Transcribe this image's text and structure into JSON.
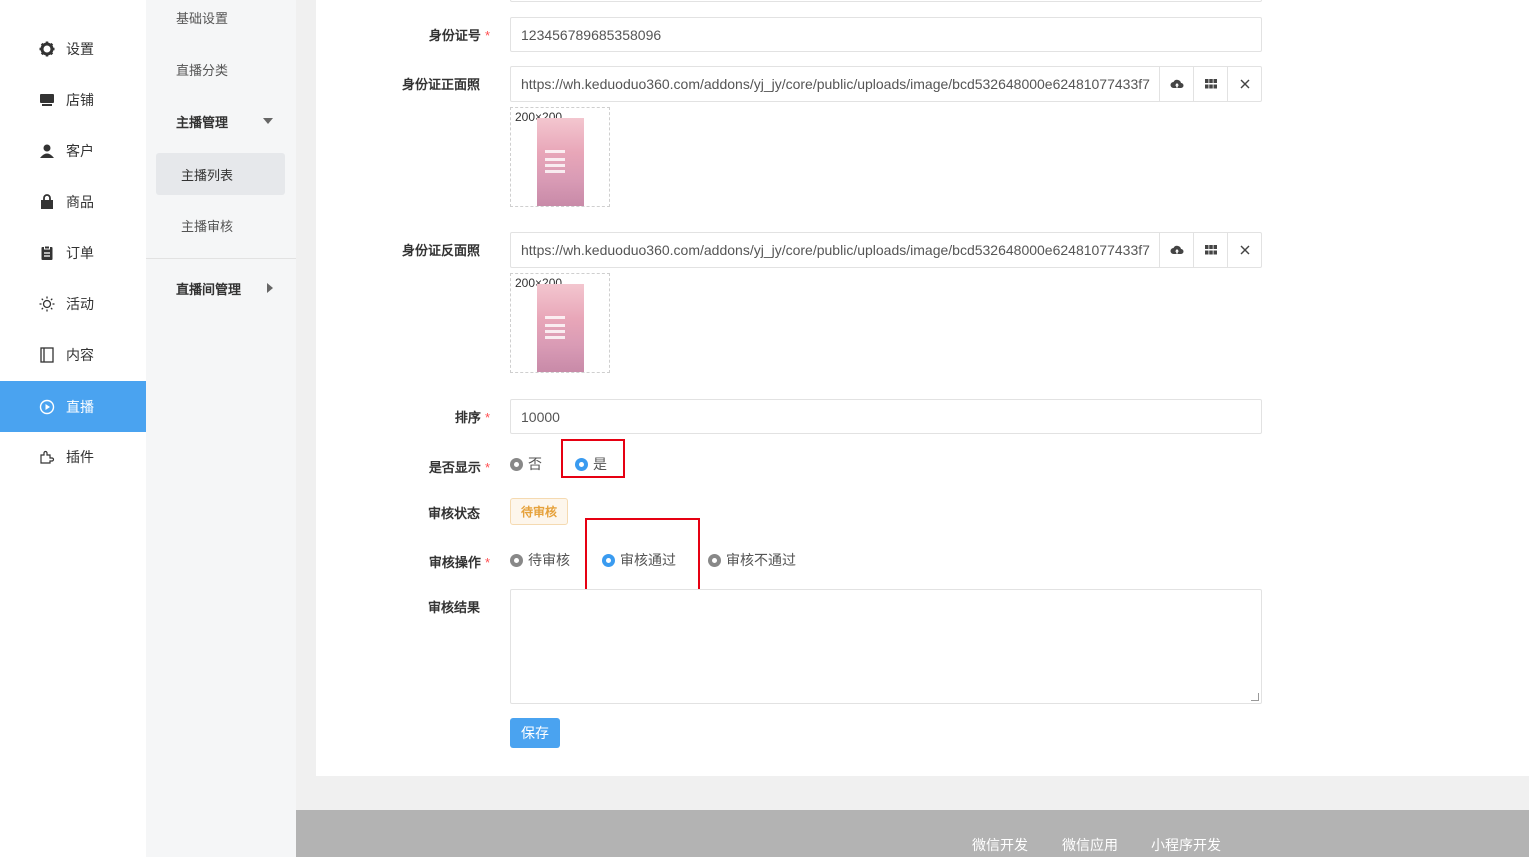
{
  "sidebar": {
    "items": [
      {
        "label": "设置",
        "icon": "gear-icon"
      },
      {
        "label": "店铺",
        "icon": "store-icon"
      },
      {
        "label": "客户",
        "icon": "user-icon"
      },
      {
        "label": "商品",
        "icon": "bag-icon"
      },
      {
        "label": "订单",
        "icon": "clipboard-icon"
      },
      {
        "label": "活动",
        "icon": "sun-icon"
      },
      {
        "label": "内容",
        "icon": "book-icon"
      },
      {
        "label": "直播",
        "icon": "play-icon"
      },
      {
        "label": "插件",
        "icon": "puzzle-icon"
      }
    ],
    "active_color": "#4aa3f0"
  },
  "subnav": {
    "basic": "基础设置",
    "category": "直播分类",
    "anchor_group": "主播管理",
    "anchor_list": "主播列表",
    "anchor_review": "主播审核",
    "room_group": "直播间管理"
  },
  "form": {
    "id_number": {
      "label": "身份证号",
      "value": "123456789685358096"
    },
    "id_front": {
      "label": "身份证正面照",
      "url": "https://wh.keduoduo360.com/addons/yj_jy/core/public/uploads/image/bcd532648000e62481077433f7",
      "thumb_size": "200×200"
    },
    "id_back": {
      "label": "身份证反面照",
      "url": "https://wh.keduoduo360.com/addons/yj_jy/core/public/uploads/image/bcd532648000e62481077433f7",
      "thumb_size": "200×200"
    },
    "sort": {
      "label": "排序",
      "value": "10000"
    },
    "display": {
      "label": "是否显示",
      "options": [
        "否",
        "是"
      ],
      "selected": "是"
    },
    "review_status": {
      "label": "审核状态",
      "value": "待审核"
    },
    "review_action": {
      "label": "审核操作",
      "options": [
        "待审核",
        "审核通过",
        "审核不通过"
      ],
      "selected": "审核通过"
    },
    "review_result": {
      "label": "审核结果",
      "value": ""
    },
    "required_mark": "*",
    "save_label": "保存"
  },
  "footer": {
    "links": [
      "微信开发",
      "微信应用",
      "小程序开发"
    ]
  }
}
